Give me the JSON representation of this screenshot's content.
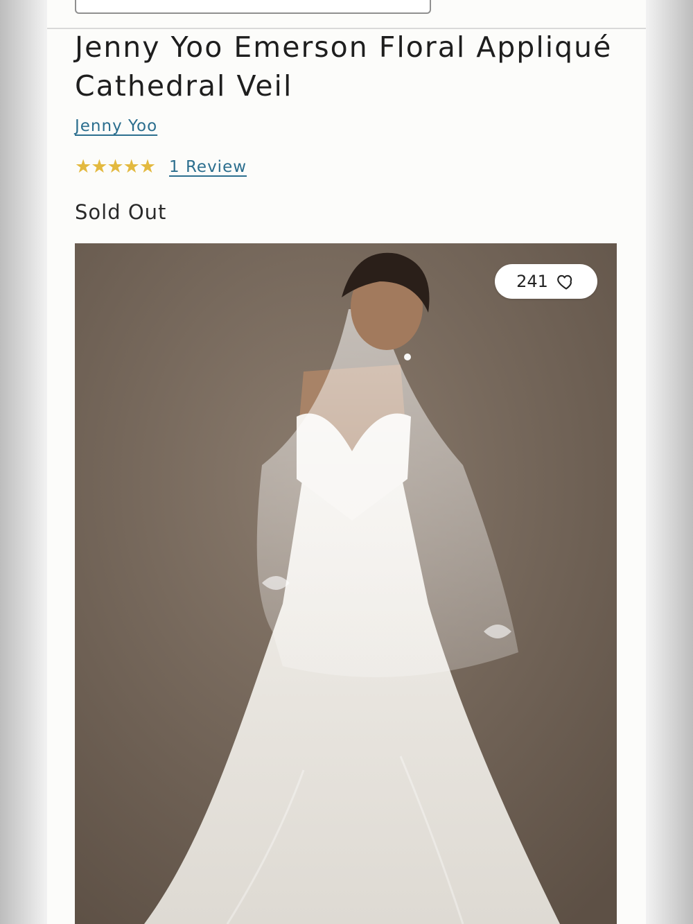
{
  "product": {
    "title": "Jenny Yoo Emerson Floral Appliqué Cathedral Veil",
    "brand": "Jenny Yoo",
    "rating": {
      "stars": "★★★★★",
      "review_link": "1 Review"
    },
    "status": "Sold Out",
    "image": {
      "like_count": "241",
      "like_icon": "heart-outline-icon"
    }
  },
  "colors": {
    "link": "#2b6e8e",
    "star": "#e3b93f",
    "backdrop": "#7a6b5e"
  }
}
